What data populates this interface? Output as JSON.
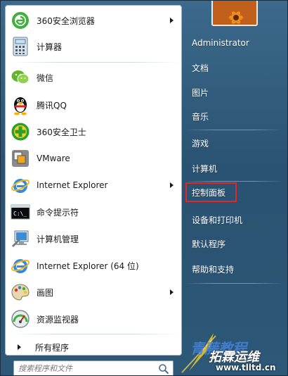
{
  "programs": [
    {
      "label": "360安全浏览器",
      "icon": "360-browser-icon",
      "has_submenu": true
    },
    {
      "label": "计算器",
      "icon": "calculator-icon",
      "has_submenu": false
    },
    {
      "label": "微信",
      "icon": "wechat-icon",
      "has_submenu": false
    },
    {
      "label": "腾讯QQ",
      "icon": "qq-penguin-icon",
      "has_submenu": false
    },
    {
      "label": "360安全卫士",
      "icon": "360-security-icon",
      "has_submenu": false
    },
    {
      "label": "VMware",
      "icon": "vmware-icon",
      "has_submenu": false
    },
    {
      "label": "Internet Explorer",
      "icon": "internet-explorer-icon",
      "has_submenu": true
    },
    {
      "label": "命令提示符",
      "icon": "command-prompt-icon",
      "has_submenu": false
    },
    {
      "label": "计算机管理",
      "icon": "computer-management-icon",
      "has_submenu": false
    },
    {
      "label": "Internet Explorer (64 位)",
      "icon": "internet-explorer-icon",
      "has_submenu": false
    },
    {
      "label": "画图",
      "icon": "paint-palette-icon",
      "has_submenu": true
    },
    {
      "label": "资源监视器",
      "icon": "resource-monitor-icon",
      "has_submenu": false
    }
  ],
  "all_programs_label": "所有程序",
  "search": {
    "placeholder": "搜索程序和文件"
  },
  "right_panel": {
    "user_name": "Administrator",
    "items": [
      "文档",
      "图片",
      "音乐",
      "游戏",
      "计算机",
      "控制面板",
      "设备和打印机",
      "默认程序",
      "帮助和支持"
    ],
    "highlighted_item": "控制面板",
    "highlight_color": "#e02828"
  },
  "watermark": {
    "line1": "青藤教程",
    "line2": "拓霖运维",
    "url": "www.tlltd.cn"
  },
  "colors": {
    "right_panel_bg": "#2d5877",
    "left_panel_bg": "#ffffff",
    "search_text": "#7a7a7a"
  }
}
